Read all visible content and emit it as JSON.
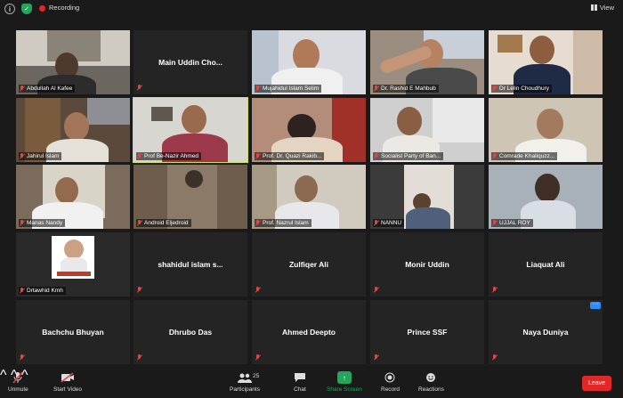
{
  "topbar": {
    "recording_label": "Recording",
    "view_label": "View"
  },
  "tiles": [
    {
      "name": "Abdullah Al Kafee",
      "type": "video",
      "scene": "s1"
    },
    {
      "name": "Main Uddin Cho...",
      "type": "name"
    },
    {
      "name": "Mujahidul Islam Selim",
      "type": "video",
      "scene": "s3"
    },
    {
      "name": "Dr. Rashid E Mahbub",
      "type": "video",
      "scene": "s4"
    },
    {
      "name": "Dr Lelin Choudhury",
      "type": "video",
      "scene": "s5"
    },
    {
      "name": "Jahirul Islam",
      "type": "video",
      "scene": "s6"
    },
    {
      "name": "Prof Be-Nazir Ahmed",
      "type": "video",
      "scene": "s7",
      "active": true
    },
    {
      "name": "Prof. Dr. Quazi Rakib...",
      "type": "video",
      "scene": "s8"
    },
    {
      "name": "Socialist Party of Ban...",
      "type": "video",
      "scene": "s9"
    },
    {
      "name": "Comrade Khaliquzz...",
      "type": "video",
      "scene": "s10"
    },
    {
      "name": "Manas Nandy",
      "type": "video",
      "scene": "s11"
    },
    {
      "name": "Android Eljedroid",
      "type": "video",
      "scene": "s12"
    },
    {
      "name": "Prof. Nazrul Islam",
      "type": "video",
      "scene": "s13"
    },
    {
      "name": "NANNU",
      "type": "video",
      "scene": "s14"
    },
    {
      "name": "UJJAL ROY",
      "type": "video",
      "scene": "s15"
    },
    {
      "name": "Drtawhid Kmh",
      "type": "video",
      "scene": "s16"
    },
    {
      "name": "shahidul islam s...",
      "type": "name"
    },
    {
      "name": "Zulfiqer Ali",
      "type": "name"
    },
    {
      "name": "Monir Uddin",
      "type": "name"
    },
    {
      "name": "Liaquat Ali",
      "type": "name"
    },
    {
      "name": "Bachchu Bhuyan",
      "type": "name"
    },
    {
      "name": "Dhrubo Das",
      "type": "name"
    },
    {
      "name": "Ahmed Deepto",
      "type": "name"
    },
    {
      "name": "Prince SSF",
      "type": "name"
    },
    {
      "name": "Naya Duniya",
      "type": "name",
      "more": true
    }
  ],
  "toolbar": {
    "unmute": "Unmute",
    "start_video": "Start Video",
    "participants": "Participants",
    "participants_count": "25",
    "chat": "Chat",
    "share_screen": "Share Screen",
    "record": "Record",
    "reactions": "Reactions",
    "leave": "Leave"
  },
  "colors": {
    "active_border": "#cfe24a",
    "share_green": "#23a65a",
    "leave_red": "#e02828",
    "muted_red": "#e34545"
  }
}
